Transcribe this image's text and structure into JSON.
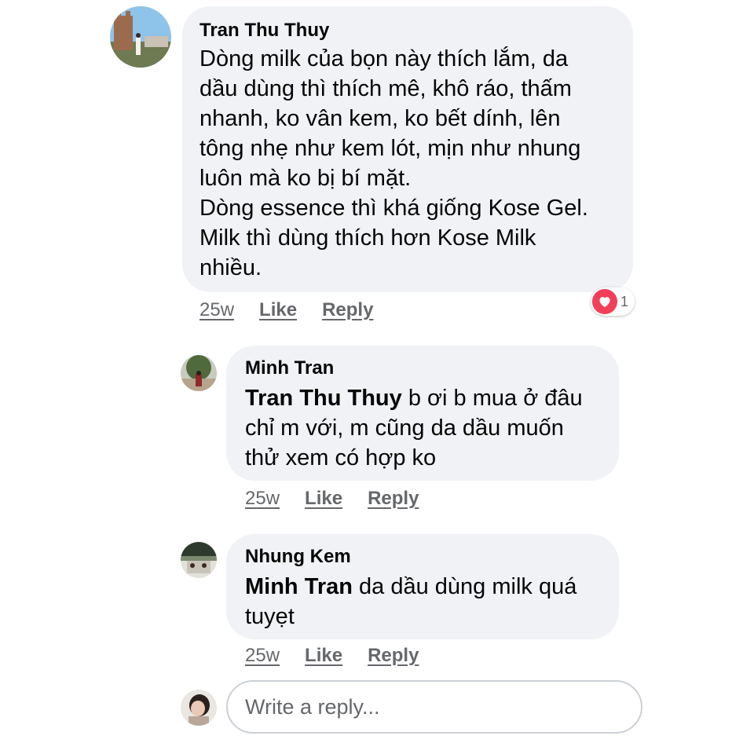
{
  "comments": [
    {
      "author": "Tran Thu Thuy",
      "mention": "",
      "text": "Dòng milk của bọn này thích lắm, da\ndầu dùng thì thích mê, khô ráo, thấm\nnhanh, ko vân kem, ko bết dính, lên\ntông nhẹ như kem lót, mịn như nhung\nluôn mà ko bị bí mặt.\nDòng essence thì khá giống Kose Gel.\nMilk thì dùng thích hơn Kose Milk\nnhiều.",
      "time": "25w",
      "like_label": "Like",
      "reply_label": "Reply",
      "reaction_count": "1",
      "reaction_icon": "heart-icon"
    },
    {
      "author": "Minh Tran",
      "mention": "Tran Thu Thuy",
      "text": " b ơi b mua ở đâu\nchỉ m với, m cũng da dầu muốn\nthử xem có hợp ko",
      "time": "25w",
      "like_label": "Like",
      "reply_label": "Reply"
    },
    {
      "author": "Nhung Kem",
      "mention": "Minh Tran",
      "text": " da dầu dùng milk quá\ntuyẹt",
      "time": "25w",
      "like_label": "Like",
      "reply_label": "Reply"
    }
  ],
  "reply_box": {
    "placeholder": "Write a reply..."
  },
  "colors": {
    "bubble": "#f0f2f5",
    "meta": "#65676b",
    "reaction": "#f33e58"
  }
}
